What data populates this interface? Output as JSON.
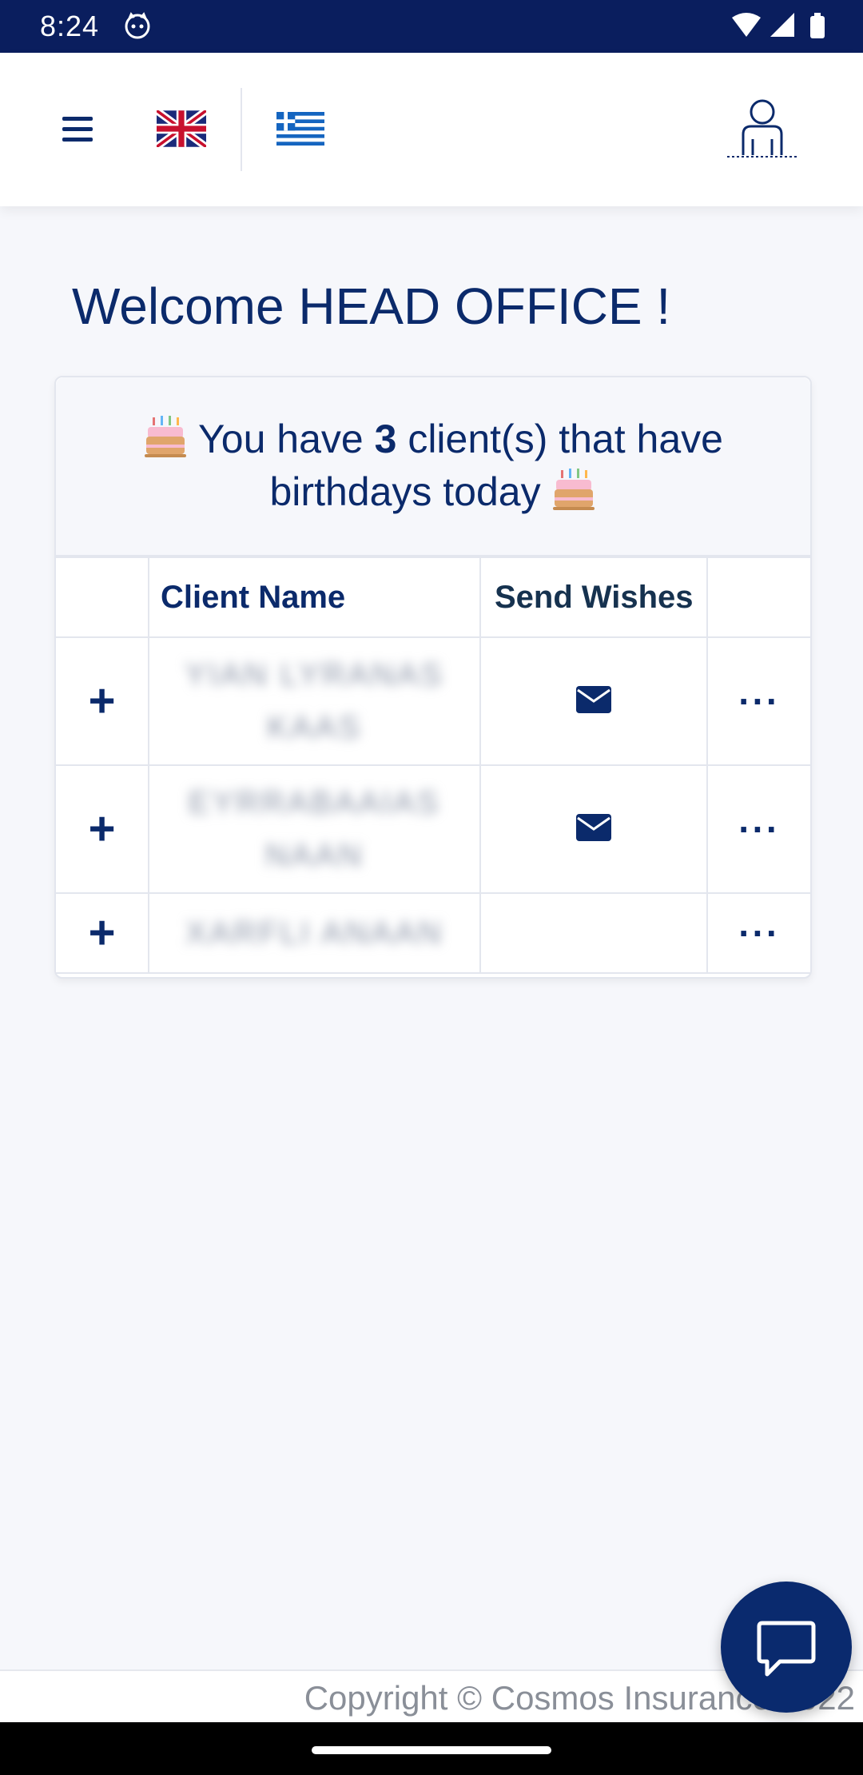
{
  "status_bar": {
    "time": "8:24",
    "icons": [
      "cat-notification-icon",
      "wifi-icon",
      "signal-icon",
      "battery-icon"
    ]
  },
  "header": {
    "icons": [
      "menu-icon",
      "uk-flag-icon",
      "greek-flag-icon",
      "user-profile-icon"
    ]
  },
  "welcome": {
    "text": "Welcome HEAD OFFICE !"
  },
  "birthday_card": {
    "message_before": " You have ",
    "count": "3",
    "message_after": " client(s) that have birthdays today ",
    "icon": "birthday-cake-icon"
  },
  "table": {
    "headers": [
      "",
      "Client Name",
      "Send Wishes",
      ""
    ],
    "rows": [
      {
        "expand": "+",
        "name": "YIAN LYRANAS KAAS",
        "has_email": true,
        "actions": "···"
      },
      {
        "expand": "+",
        "name": "EYRRABAAIAS NAAN",
        "has_email": true,
        "actions": "···"
      },
      {
        "expand": "+",
        "name": "XARFLI ANAAN",
        "has_email": false,
        "actions": "···"
      }
    ]
  },
  "footer": {
    "copyright": "Copyright © Cosmos Insurance 2022"
  },
  "chat_button": {
    "icon": "chat-icon"
  },
  "colors": {
    "primary": "#0b2a6b",
    "status_bar": "#0a1e5e",
    "background": "#f6f7fb",
    "border": "#e3e6ee"
  }
}
